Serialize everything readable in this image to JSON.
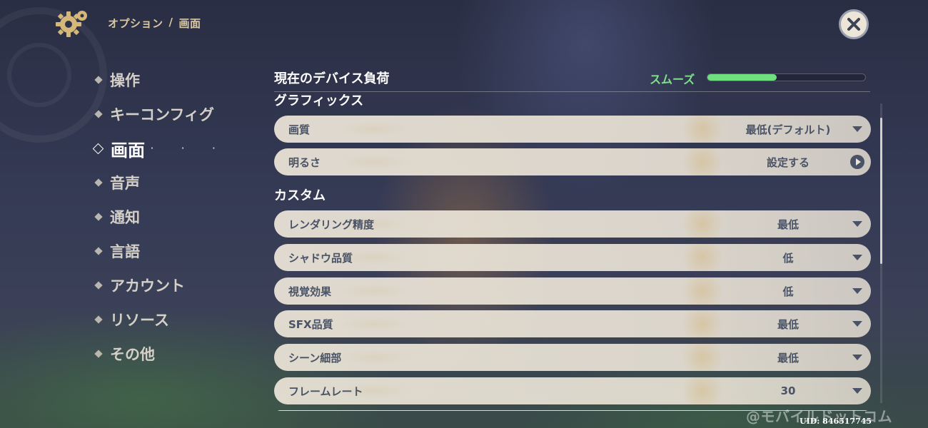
{
  "header": {
    "breadcrumb": [
      "オプション",
      "/",
      "画面"
    ]
  },
  "nav": {
    "items": [
      {
        "label": "操作",
        "active": false
      },
      {
        "label": "キーコンフィグ",
        "active": false
      },
      {
        "label": "画面",
        "active": true
      },
      {
        "label": "音声",
        "active": false
      },
      {
        "label": "通知",
        "active": false
      },
      {
        "label": "言語",
        "active": false
      },
      {
        "label": "アカウント",
        "active": false
      },
      {
        "label": "リソース",
        "active": false
      },
      {
        "label": "その他",
        "active": false
      }
    ]
  },
  "device_load": {
    "label": "現在のデバイス負荷",
    "status": "スムーズ",
    "level": 0.44,
    "status_color": "#7fe08a"
  },
  "sections": {
    "graphics": "グラフィックス",
    "custom": "カスタム"
  },
  "settings": {
    "graphics": [
      {
        "label": "画質",
        "value": "最低(デフォルト)",
        "control": "dropdown"
      },
      {
        "label": "明るさ",
        "value": "設定する",
        "control": "navigate"
      }
    ],
    "custom": [
      {
        "label": "レンダリング精度",
        "value": "最低",
        "control": "dropdown"
      },
      {
        "label": "シャドウ品質",
        "value": "低",
        "control": "dropdown"
      },
      {
        "label": "視覚効果",
        "value": "低",
        "control": "dropdown"
      },
      {
        "label": "SFX品質",
        "value": "最低",
        "control": "dropdown"
      },
      {
        "label": "シーン細部",
        "value": "最低",
        "control": "dropdown"
      },
      {
        "label": "フレームレート",
        "value": "30",
        "control": "dropdown"
      }
    ]
  },
  "footer": {
    "watermark": "@モバイルドットコム",
    "uid": "UID: 846517745"
  },
  "colors": {
    "accent": "#ece5d8",
    "row_text": "#4a5366",
    "breadcrumb": "#d9c9a3"
  },
  "icons": {
    "settings": "gear-icon",
    "close": "close-icon",
    "dropdown": "caret-down-icon",
    "navigate": "arrow-right-circle-icon"
  }
}
